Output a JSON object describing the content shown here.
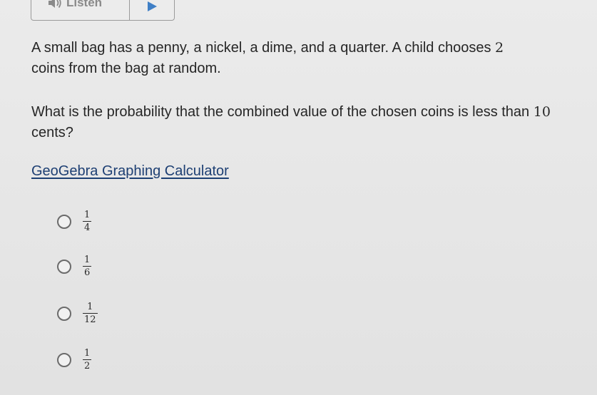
{
  "toolbar": {
    "listen_label": "Listen",
    "listen_icon": "speaker-icon",
    "play_icon": "play-icon"
  },
  "question": {
    "stem_text": "A small bag has a penny, a nickel, a dime, and a quarter. A child chooses",
    "stem_number": "2",
    "stem_line2": "coins from the bag at random.",
    "prompt_text": "What is the probability that the combined value of the chosen coins is less than",
    "prompt_number": "10",
    "prompt_tail": "cents?"
  },
  "calculator_link": "GeoGebra Graphing Calculator",
  "choices": [
    {
      "numerator": "1",
      "denominator": "4"
    },
    {
      "numerator": "1",
      "denominator": "6"
    },
    {
      "numerator": "1",
      "denominator": "12"
    },
    {
      "numerator": "1",
      "denominator": "2"
    }
  ],
  "colors": {
    "accent": "#3f7fc6",
    "link": "#1d3f73"
  }
}
